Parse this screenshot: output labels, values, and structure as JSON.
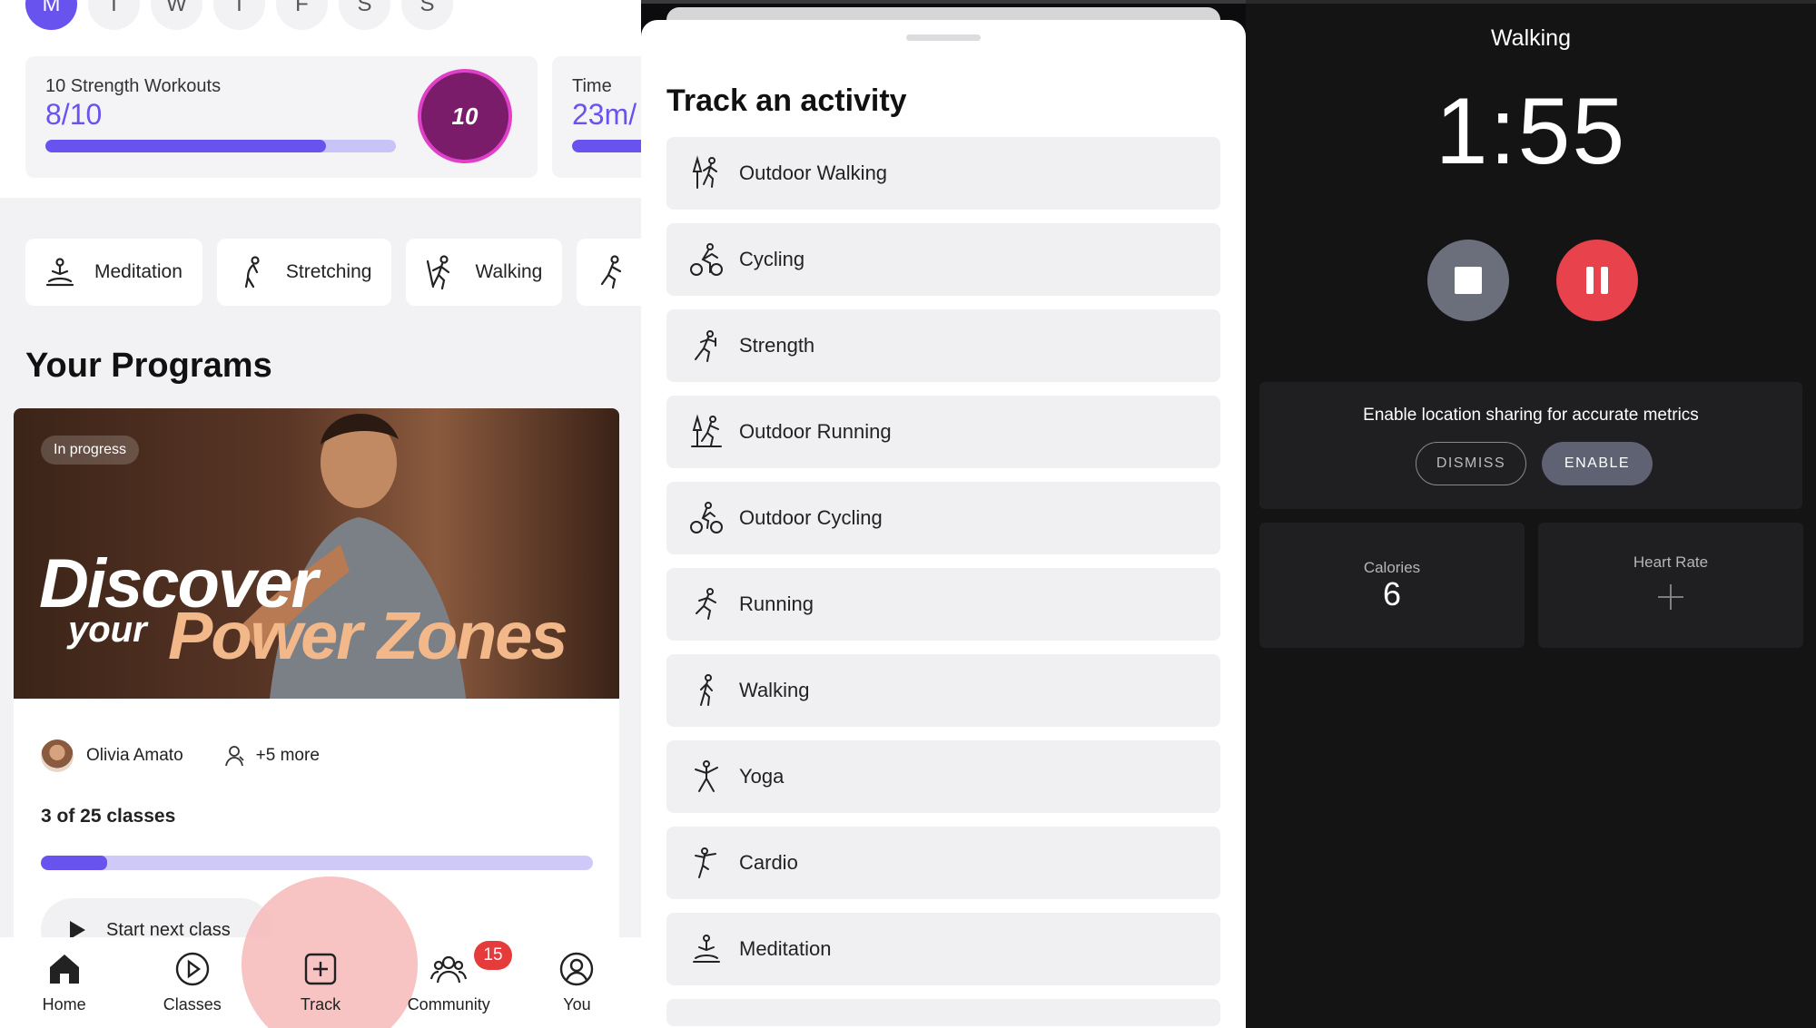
{
  "home": {
    "weekdays": [
      "M",
      "T",
      "W",
      "T",
      "F",
      "S",
      "S"
    ],
    "goals": [
      {
        "title": "10 Strength Workouts",
        "value": "8/10",
        "progress": 0.8,
        "badge": "10"
      },
      {
        "title": "Time",
        "value": "23m/",
        "progress": 0.5
      }
    ],
    "quick_chips": [
      {
        "label": "Meditation",
        "icon": "meditation-icon"
      },
      {
        "label": "Stretching",
        "icon": "stretching-icon"
      },
      {
        "label": "Walking",
        "icon": "walking-icon"
      },
      {
        "label": "",
        "icon": "running-icon"
      }
    ],
    "programs_title": "Your Programs",
    "program": {
      "status": "In progress",
      "hero_line1": "Discover",
      "hero_line2": "your",
      "hero_line3": "Power Zones",
      "instructor": "Olivia Amato",
      "more": "+5 more",
      "classes": "3 of 25 classes",
      "progress": 0.12,
      "start_label": "Start next class"
    },
    "tabs": [
      {
        "label": "Home",
        "icon": "home-icon"
      },
      {
        "label": "Classes",
        "icon": "play-circle-icon"
      },
      {
        "label": "Track",
        "icon": "plus-square-icon"
      },
      {
        "label": "Community",
        "icon": "community-icon",
        "badge": "15"
      },
      {
        "label": "You",
        "icon": "profile-icon"
      }
    ],
    "colors": {
      "accent": "#6953ef",
      "badge": "#e53b3b",
      "track_highlight": "#f6b8b8"
    }
  },
  "track_sheet": {
    "title": "Track an activity",
    "activities": [
      {
        "label": "Outdoor Walking",
        "icon": "outdoor-walking-icon"
      },
      {
        "label": "Cycling",
        "icon": "cycling-icon"
      },
      {
        "label": "Strength",
        "icon": "strength-icon"
      },
      {
        "label": "Outdoor Running",
        "icon": "outdoor-running-icon"
      },
      {
        "label": "Outdoor Cycling",
        "icon": "outdoor-cycling-icon"
      },
      {
        "label": "Running",
        "icon": "running-icon"
      },
      {
        "label": "Walking",
        "icon": "walking-icon"
      },
      {
        "label": "Yoga",
        "icon": "yoga-icon"
      },
      {
        "label": "Cardio",
        "icon": "cardio-icon"
      },
      {
        "label": "Meditation",
        "icon": "meditation-icon"
      }
    ]
  },
  "workout": {
    "title": "Walking",
    "timer": "1:55",
    "location_prompt": "Enable location sharing for accurate metrics",
    "dismiss_label": "DISMISS",
    "enable_label": "ENABLE",
    "calories_label": "Calories",
    "calories_value": "6",
    "heart_rate_label": "Heart Rate",
    "colors": {
      "stop": "#6b6f7c",
      "pause": "#e8424c"
    }
  }
}
